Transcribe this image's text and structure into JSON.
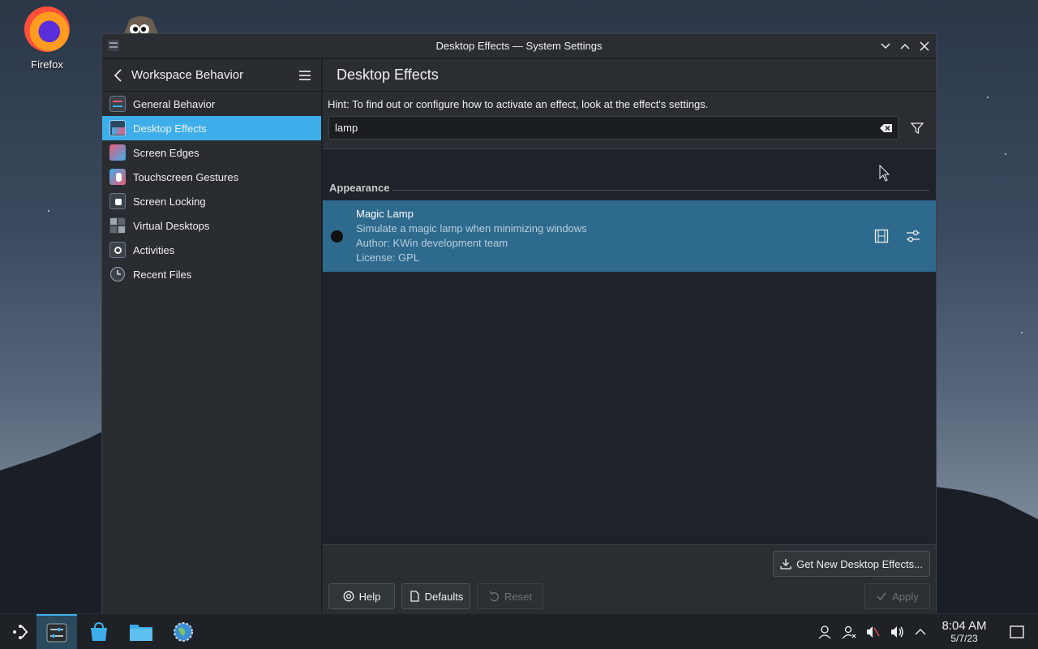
{
  "desktop": {
    "firefox_label": "Firefox"
  },
  "window": {
    "title": "Desktop Effects — System Settings"
  },
  "sidebar": {
    "header": "Workspace Behavior",
    "items": [
      {
        "label": "General Behavior",
        "active": false
      },
      {
        "label": "Desktop Effects",
        "active": true
      },
      {
        "label": "Screen Edges",
        "active": false
      },
      {
        "label": "Touchscreen Gestures",
        "active": false
      },
      {
        "label": "Screen Locking",
        "active": false
      },
      {
        "label": "Virtual Desktops",
        "active": false
      },
      {
        "label": "Activities",
        "active": false
      },
      {
        "label": "Recent Files",
        "active": false
      }
    ]
  },
  "main": {
    "title": "Desktop Effects",
    "hint": "Hint: To find out or configure how to activate an effect, look at the effect's settings.",
    "search_value": "lamp",
    "section": "Appearance",
    "effect": {
      "name": "Magic Lamp",
      "description": "Simulate a magic lamp when minimizing windows",
      "author": "Author: KWin development team",
      "license": "License: GPL"
    }
  },
  "footer": {
    "get_new_label": "Get New Desktop Effects...",
    "help_label": "Help",
    "defaults_label": "Defaults",
    "reset_label": "Reset",
    "apply_label": "Apply"
  },
  "taskbar": {
    "time": "8:04 AM",
    "date": "5/7/23"
  },
  "colors": {
    "accent": "#3daee9",
    "selected_row": "#2e6a8e"
  }
}
